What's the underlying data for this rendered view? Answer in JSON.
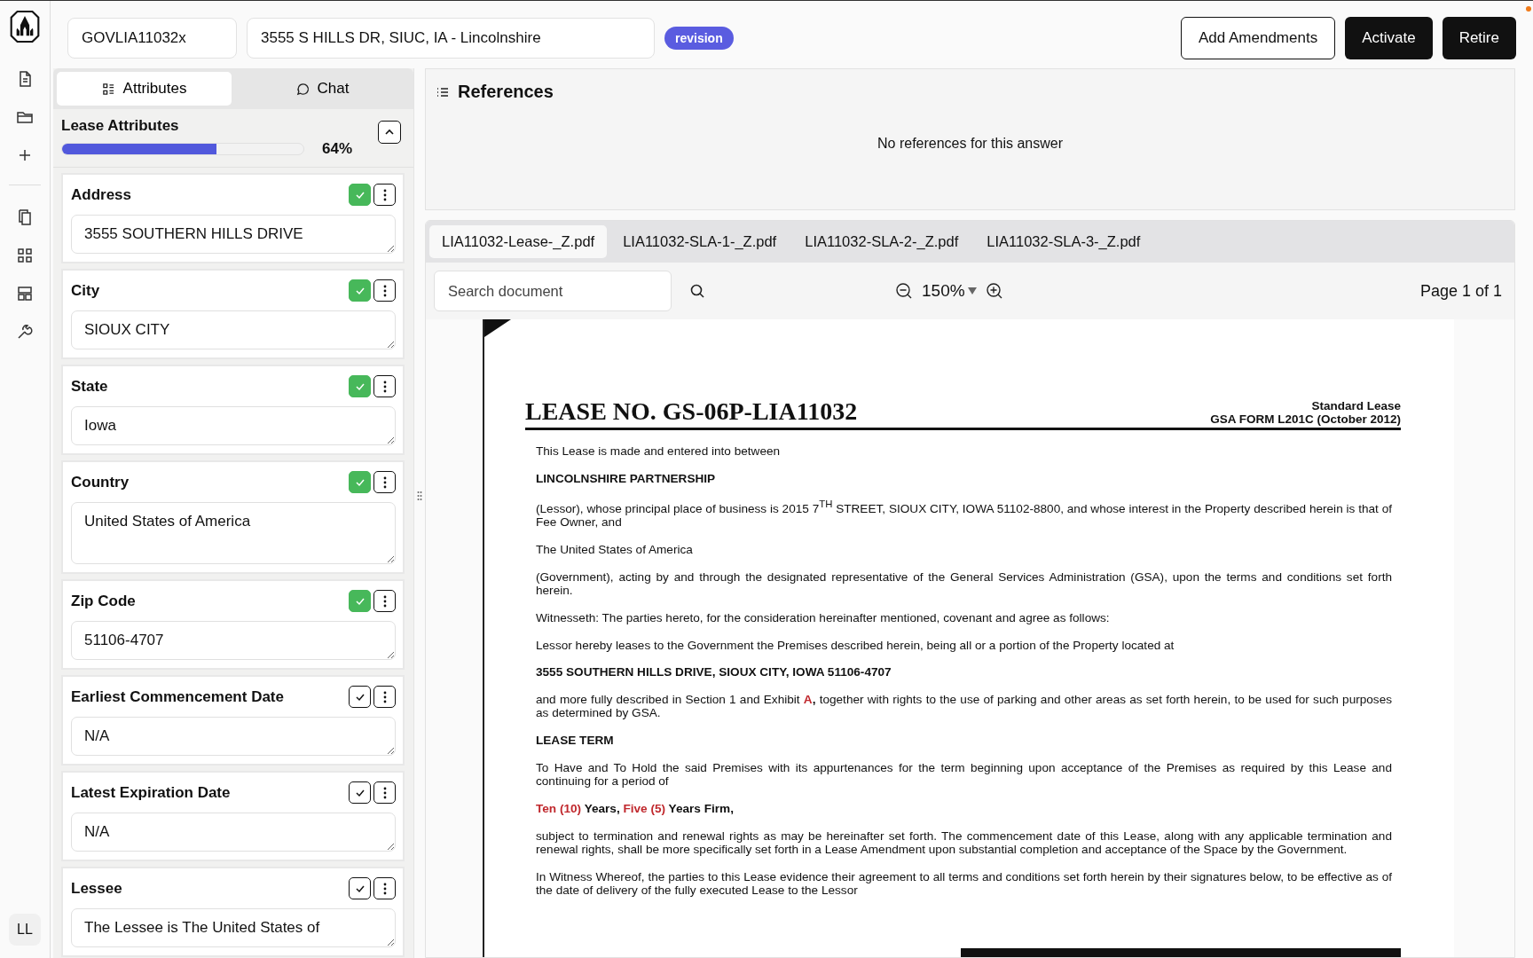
{
  "nav": {
    "avatar": "LL"
  },
  "header": {
    "record_id": "GOVLIA11032x",
    "address": "3555 S HILLS DR, SIUC, IA - Lincolnshire",
    "badge": "revision",
    "buttons": [
      {
        "label": "Add Amendments",
        "kind": "outline"
      },
      {
        "label": "Activate",
        "kind": "solid"
      },
      {
        "label": "Retire",
        "kind": "solid"
      }
    ]
  },
  "panel_tabs": [
    {
      "label": "Attributes",
      "selected": true
    },
    {
      "label": "Chat",
      "selected": false
    }
  ],
  "attributes": {
    "title": "Lease Attributes",
    "level": 0.64,
    "percent": "64%",
    "expanded": true,
    "items": [
      {
        "label": "Address",
        "value": "3555 SOUTHERN HILLS DRIVE",
        "verified": true,
        "tall": false
      },
      {
        "label": "City",
        "value": "SIOUX CITY",
        "verified": true,
        "tall": false
      },
      {
        "label": "State",
        "value": "Iowa",
        "verified": true,
        "tall": false
      },
      {
        "label": "Country",
        "value": "United States of America",
        "verified": true,
        "tall": true
      },
      {
        "label": "Zip Code",
        "value": "51106-4707",
        "verified": true,
        "tall": false
      },
      {
        "label": "Earliest Commencement Date",
        "value": "N/A",
        "verified": false,
        "tall": false
      },
      {
        "label": "Latest Expiration Date",
        "value": "N/A",
        "verified": false,
        "tall": false
      },
      {
        "label": "Lessee",
        "value": "The Lessee is The United States of",
        "verified": false,
        "tall": false
      }
    ]
  },
  "references": {
    "title": "References",
    "empty_text": "No references for this answer"
  },
  "viewer": {
    "files": [
      {
        "label": "LIA11032-Lease-_Z.pdf",
        "selected": true
      },
      {
        "label": "LIA11032-SLA-1-_Z.pdf",
        "selected": false
      },
      {
        "label": "LIA11032-SLA-2-_Z.pdf",
        "selected": false
      },
      {
        "label": "LIA11032-SLA-3-_Z.pdf",
        "selected": false
      }
    ],
    "search": {
      "placeholder": "Search document"
    },
    "zoom": "150%",
    "page": "Page 1 of 1",
    "document": {
      "title": "LEASE NO. GS-06P-LIA11032",
      "form_line_1": "Standard Lease",
      "form_line_2": "GSA FORM L201C (October 2012)",
      "paragraphs": [
        {
          "bold": false,
          "segments": [
            {
              "text": "This Lease is made and entered into between",
              "red": false
            }
          ]
        },
        {
          "bold": true,
          "segments": [
            {
              "text": "LINCOLNSHIRE PARTNERSHIP",
              "red": false
            }
          ]
        },
        {
          "bold": false,
          "segments": [
            {
              "text": "(Lessor), whose principal place of business is 2015 7$^{TH}$ STREET, SIOUX CITY, IOWA 51102-8800, and whose interest in the Property described herein is that of Fee Owner, and",
              "red": false
            }
          ]
        },
        {
          "bold": false,
          "segments": [
            {
              "text": "The United States of America",
              "red": false
            }
          ]
        },
        {
          "bold": false,
          "segments": [
            {
              "text": "(Government), acting by and through the designated representative of the General Services Administration (GSA), upon the terms and conditions set forth herein.",
              "red": false
            }
          ]
        },
        {
          "bold": false,
          "segments": [
            {
              "text": "Witnesseth: The parties hereto, for the consideration hereinafter mentioned, covenant and agree as follows:",
              "red": false
            }
          ]
        },
        {
          "bold": false,
          "segments": [
            {
              "text": "Lessor hereby leases to the Government the Premises described herein, being all or a portion of the Property located at",
              "red": false
            }
          ]
        },
        {
          "bold": true,
          "segments": [
            {
              "text": "3555 SOUTHERN HILLS DRIVE, SIOUX CITY, IOWA 51106-4707",
              "red": false
            }
          ]
        },
        {
          "bold": false,
          "segments": [
            {
              "text": "and more fully described in Section 1 and Exhibit ",
              "red": false
            },
            {
              "text": "**A**",
              "red": true
            },
            {
              "text": "**,** together with rights to the use of parking and other areas as set forth herein, to be used for such purposes as determined by GSA.",
              "red": false
            }
          ]
        },
        {
          "bold": true,
          "segments": [
            {
              "text": "LEASE TERM",
              "red": false
            }
          ]
        },
        {
          "bold": false,
          "segments": [
            {
              "text": "To Have and To Hold the said Premises with its appurtenances for the term beginning upon acceptance of the Premises as required by this Lease and continuing for a period of",
              "red": false
            }
          ]
        },
        {
          "bold": true,
          "segments": [
            {
              "text": "Ten (10)",
              "red": true
            },
            {
              "text": " Years, ",
              "red": false
            },
            {
              "text": "Five (5)",
              "red": true
            },
            {
              "text": " Years Firm,",
              "red": false
            }
          ]
        },
        {
          "bold": false,
          "segments": [
            {
              "text": "subject to termination and renewal rights as may be hereinafter set forth.  The commencement date of this Lease, along with any applicable termination and renewal rights, shall be more specifically set forth in a Lease Amendment upon substantial completion and acceptance of the Space by the Government.",
              "red": false
            }
          ]
        },
        {
          "bold": false,
          "segments": [
            {
              "text": "In Witness Whereof, the parties to this Lease evidence their agreement to all terms and conditions set forth herein by their signatures below, to be effective as of the date of delivery of the fully executed Lease to the Lessor",
              "red": false
            }
          ]
        }
      ]
    }
  }
}
